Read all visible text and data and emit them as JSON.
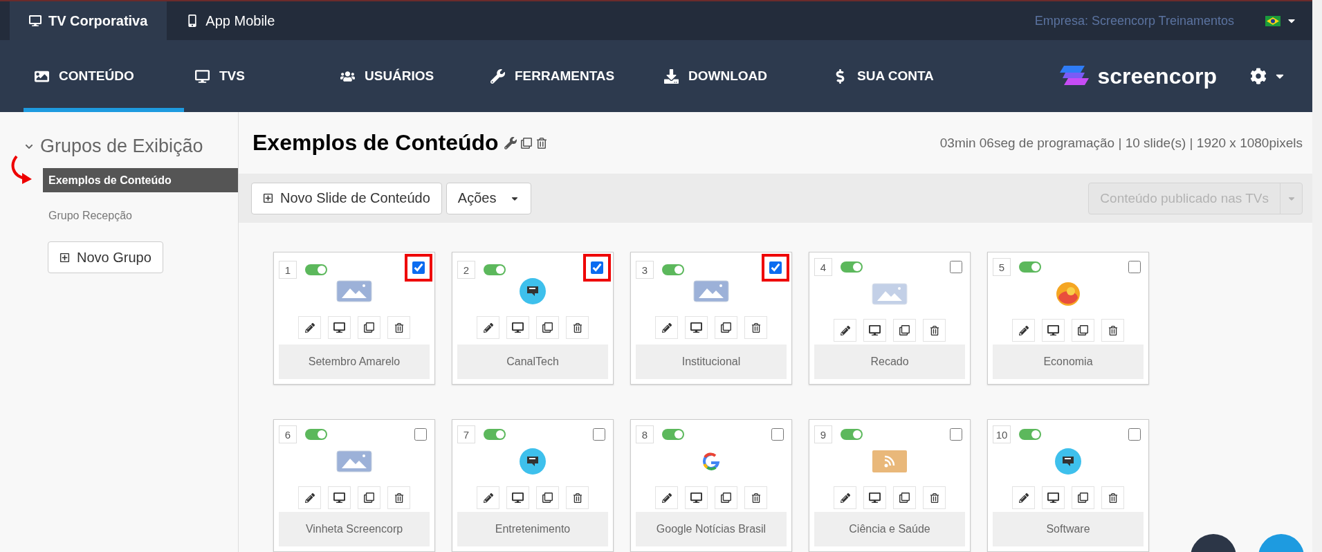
{
  "top_tabs": [
    {
      "label": "TV Corporativa",
      "kind": "tv",
      "selected": true
    },
    {
      "label": "App Mobile",
      "kind": "phone",
      "selected": false
    }
  ],
  "company": "Empresa: Screencorp Treinamentos",
  "nav": [
    {
      "label": "CONTEÚDO",
      "kind": "image",
      "selected": true
    },
    {
      "label": "TVS",
      "kind": "tv",
      "selected": false
    },
    {
      "label": "USUÁRIOS",
      "kind": "users",
      "selected": false
    },
    {
      "label": "FERRAMENTAS",
      "kind": "wrench",
      "selected": false
    },
    {
      "label": "DOWNLOAD",
      "kind": "download",
      "selected": false
    },
    {
      "label": "SUA CONTA",
      "kind": "dollar",
      "selected": false
    }
  ],
  "logo": "screencorp",
  "sidebar": {
    "title": "Grupos de Exibição",
    "expanded": true,
    "items": [
      {
        "label": "Exemplos de Conteúdo",
        "selected": true
      },
      {
        "label": "Grupo Recepção",
        "selected": false
      }
    ],
    "new_group": "Novo Grupo"
  },
  "content": {
    "title": "Exemplos de Conteúdo",
    "info": "03min 06seg de programação | 10 slide(s) | 1920 x 1080pixels",
    "new_slide": "Novo Slide de Conteúdo",
    "actions": "Ações",
    "publish": "Conteúdo publicado nas TVs"
  },
  "slides": [
    {
      "number": "1",
      "on": true,
      "checked": true,
      "kind": "image",
      "name": "Setembro Amarelo"
    },
    {
      "number": "2",
      "on": true,
      "checked": true,
      "kind": "canaltech",
      "name": "CanalTech"
    },
    {
      "number": "3",
      "on": true,
      "checked": true,
      "kind": "image",
      "name": "Institucional"
    },
    {
      "number": "4",
      "on": true,
      "checked": false,
      "kind": "image-faded",
      "name": "Recado"
    },
    {
      "number": "5",
      "on": true,
      "checked": false,
      "kind": "economy",
      "name": "Economia"
    },
    {
      "number": "6",
      "on": true,
      "checked": false,
      "kind": "image",
      "name": "Vinheta Screencorp"
    },
    {
      "number": "7",
      "on": true,
      "checked": false,
      "kind": "canaltech",
      "name": "Entretenimento"
    },
    {
      "number": "8",
      "on": true,
      "checked": false,
      "kind": "google",
      "name": "Google Notícias Brasil"
    },
    {
      "number": "9",
      "on": true,
      "checked": false,
      "kind": "rss",
      "name": "Ciência e Saúde"
    },
    {
      "number": "10",
      "on": true,
      "checked": false,
      "kind": "canaltech",
      "name": "Software"
    }
  ]
}
